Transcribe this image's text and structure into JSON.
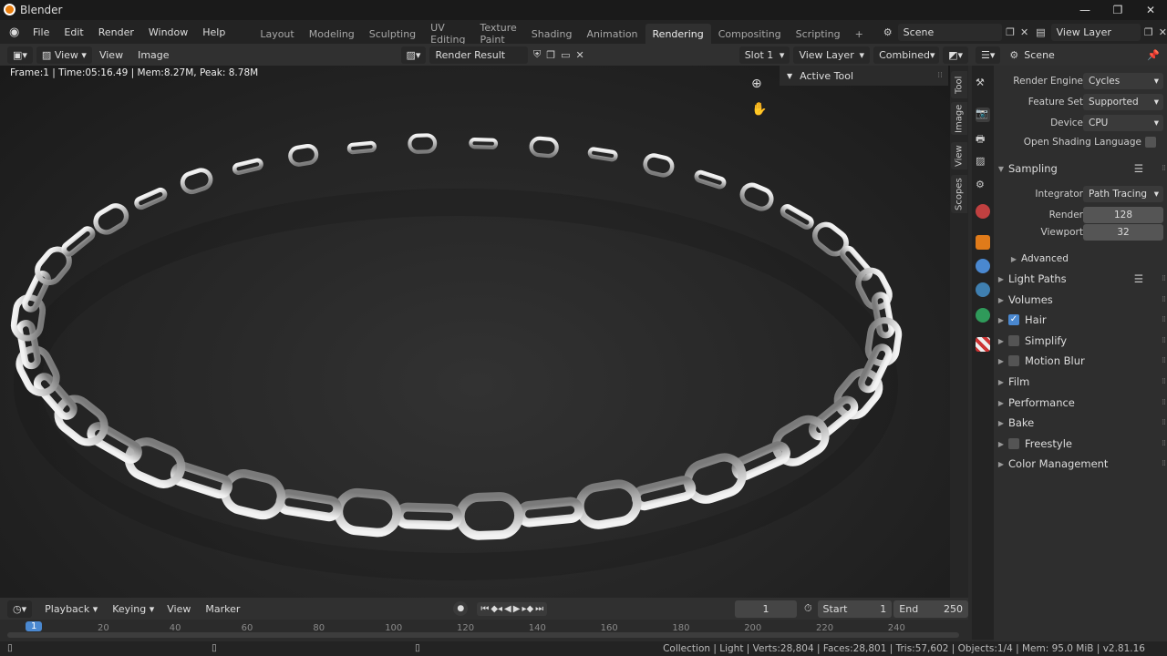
{
  "window": {
    "title": "Blender",
    "min": "—",
    "max": "❐",
    "close": "✕"
  },
  "menu": [
    "File",
    "Edit",
    "Render",
    "Window",
    "Help"
  ],
  "workspaces": [
    "Layout",
    "Modeling",
    "Sculpting",
    "UV Editing",
    "Texture Paint",
    "Shading",
    "Animation",
    "Rendering",
    "Compositing",
    "Scripting"
  ],
  "active_workspace": "Rendering",
  "scene_field": "Scene",
  "view_layer_field": "View Layer",
  "image_editor": {
    "view_menu": "View",
    "menu_view": "View",
    "menu_image": "Image",
    "render_result": "Render Result",
    "slot": "Slot 1",
    "layer": "View Layer",
    "pass": "Combined"
  },
  "render_stats": "Frame:1 | Time:05:16.49 | Mem:8.27M, Peak: 8.78M",
  "active_tool": "Active Tool",
  "side_tabs": [
    "Tool",
    "Image",
    "View",
    "Scopes"
  ],
  "properties": {
    "context": "Scene",
    "render_engine_label": "Render Engine",
    "render_engine": "Cycles",
    "feature_set_label": "Feature Set",
    "feature_set": "Supported",
    "device_label": "Device",
    "device": "CPU",
    "osl_label": "Open Shading Language",
    "sampling": "Sampling",
    "integrator_label": "Integrator",
    "integrator": "Path Tracing",
    "render_label": "Render",
    "render_samples": "128",
    "viewport_label": "Viewport",
    "viewport_samples": "32",
    "advanced": "Advanced",
    "sections": [
      "Light Paths",
      "Volumes",
      "Hair",
      "Simplify",
      "Motion Blur",
      "Film",
      "Performance",
      "Bake",
      "Freestyle",
      "Color Management"
    ]
  },
  "timeline": {
    "playback": "Playback",
    "keying": "Keying",
    "view": "View",
    "marker": "Marker",
    "current_frame": "1",
    "start_label": "Start",
    "start": "1",
    "end_label": "End",
    "end": "250",
    "ticks": [
      "1",
      "20",
      "40",
      "60",
      "80",
      "100",
      "120",
      "140",
      "160",
      "180",
      "200",
      "220",
      "240"
    ]
  },
  "status": "Collection | Light | Verts:28,804 | Faces:28,801 | Tris:57,602 | Objects:1/4 | Mem: 95.0 MiB | v2.81.16"
}
